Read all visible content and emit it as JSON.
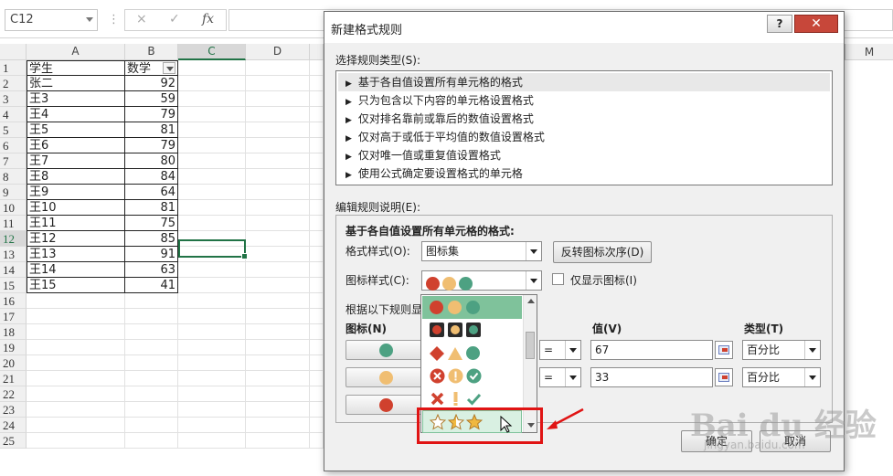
{
  "formula_bar": {
    "name_box": "C12",
    "cancel_icon": "×",
    "enter_icon": "✓",
    "fx_label": "fx",
    "separator": "⋮"
  },
  "grid": {
    "column_headers": [
      "A",
      "B",
      "C",
      "D"
    ],
    "far_column_header": "M",
    "selected_column": "C",
    "selected_row": 12,
    "rows": [
      {
        "n": "1",
        "a": "学生",
        "b": "数学",
        "header": true
      },
      {
        "n": "2",
        "a": "张二",
        "b": "92"
      },
      {
        "n": "3",
        "a": "王3",
        "b": "59"
      },
      {
        "n": "4",
        "a": "王4",
        "b": "79"
      },
      {
        "n": "5",
        "a": "王5",
        "b": "81"
      },
      {
        "n": "6",
        "a": "王6",
        "b": "79"
      },
      {
        "n": "7",
        "a": "王7",
        "b": "80"
      },
      {
        "n": "8",
        "a": "王8",
        "b": "84"
      },
      {
        "n": "9",
        "a": "王9",
        "b": "64"
      },
      {
        "n": "10",
        "a": "王10",
        "b": "81"
      },
      {
        "n": "11",
        "a": "王11",
        "b": "75"
      },
      {
        "n": "12",
        "a": "王12",
        "b": "85"
      },
      {
        "n": "13",
        "a": "王13",
        "b": "91"
      },
      {
        "n": "14",
        "a": "王14",
        "b": "63"
      },
      {
        "n": "15",
        "a": "王15",
        "b": "41"
      },
      {
        "n": "16",
        "a": "",
        "b": ""
      },
      {
        "n": "17",
        "a": "",
        "b": ""
      },
      {
        "n": "18",
        "a": "",
        "b": ""
      },
      {
        "n": "19",
        "a": "",
        "b": ""
      },
      {
        "n": "20",
        "a": "",
        "b": ""
      },
      {
        "n": "21",
        "a": "",
        "b": ""
      },
      {
        "n": "22",
        "a": "",
        "b": ""
      },
      {
        "n": "23",
        "a": "",
        "b": ""
      },
      {
        "n": "24",
        "a": "",
        "b": ""
      },
      {
        "n": "25",
        "a": "",
        "b": ""
      }
    ]
  },
  "dialog": {
    "title": "新建格式规则",
    "help_label": "?",
    "close_label": "✕",
    "rule_type_label": "选择规则类型(S):",
    "rule_types": [
      "基于各自值设置所有单元格的格式",
      "只为包含以下内容的单元格设置格式",
      "仅对排名靠前或靠后的数值设置格式",
      "仅对高于或低于平均值的数值设置格式",
      "仅对唯一值或重复值设置格式",
      "使用公式确定要设置格式的单元格"
    ],
    "edit_desc_label": "编辑规则说明(E):",
    "desc_heading": "基于各自值设置所有单元格的格式:",
    "format_style_label": "格式样式(O):",
    "format_style_value": "图标集",
    "reverse_button": "反转图标次序(D)",
    "icon_style_label": "图标样式(C):",
    "show_icon_only_label": "仅显示图标(I)",
    "rule_display_label": "根据以下规则显",
    "icon_col_label": "图标(N)",
    "value_col_label": "值(V)",
    "type_col_label": "类型(T)",
    "rule_rows": [
      {
        "operator": "=",
        "value": "67",
        "type": "百分比"
      },
      {
        "operator": "=",
        "value": "33",
        "type": "百分比"
      }
    ],
    "ok_button": "确定",
    "cancel_button": "取消"
  },
  "watermark": {
    "logo_text": "Bai du 经验",
    "sub_text": "jingyan.baidu.com"
  },
  "colors": {
    "red": "#d0412e",
    "amber": "#f0be72",
    "green": "#4da182",
    "excel_green": "#217346",
    "highlight_box": "#e01414"
  }
}
